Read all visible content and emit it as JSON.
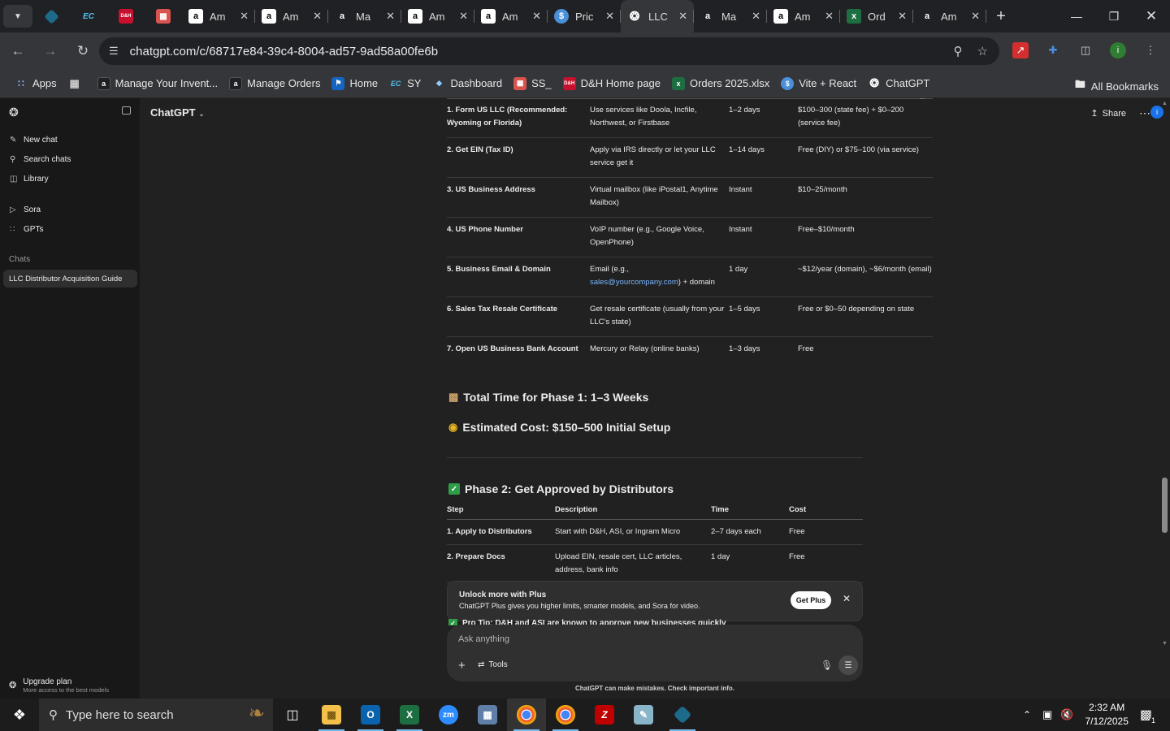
{
  "browser": {
    "tabs": [
      {
        "icon": "amazon-icon",
        "title": "Am"
      },
      {
        "icon": "amazon-icon",
        "title": "Am"
      },
      {
        "icon": "amazon-icon",
        "title": "Ma"
      },
      {
        "icon": "amazon-icon",
        "title": "Am"
      },
      {
        "icon": "amazon-icon",
        "title": "Am"
      },
      {
        "icon": "dollar-icon",
        "title": "Pric"
      },
      {
        "icon": "openai-icon",
        "title": "LLC"
      },
      {
        "icon": "amazon-icon",
        "title": "Ma"
      },
      {
        "icon": "amazon-icon",
        "title": "Am"
      },
      {
        "icon": "excel-icon",
        "title": "Ord"
      },
      {
        "icon": "amazon-icon",
        "title": "Am"
      }
    ],
    "pinned_labels": [
      "EC",
      "D&H"
    ],
    "url": "chatgpt.com/c/68717e84-39c4-8004-ad57-9ad58a00fe6b",
    "profile_initial": "i",
    "bookmarks": [
      {
        "label": "Apps",
        "icon": "apps-grid-icon"
      },
      {
        "label": "",
        "icon": "grid-icon"
      },
      {
        "label": "Manage Your Invent...",
        "icon": "amazon-icon"
      },
      {
        "label": "Manage Orders",
        "icon": "amazon-icon"
      },
      {
        "label": "Home",
        "icon": "site-icon"
      },
      {
        "label": "SY",
        "icon": "ec-icon"
      },
      {
        "label": "Dashboard",
        "icon": "dashboard-icon"
      },
      {
        "label": "SS_",
        "icon": "box-icon"
      },
      {
        "label": "D&H Home page",
        "icon": "dh-icon"
      },
      {
        "label": "Orders 2025.xlsx",
        "icon": "excel-icon"
      },
      {
        "label": "Vite + React",
        "icon": "dollar-icon"
      },
      {
        "label": "ChatGPT",
        "icon": "openai-icon"
      }
    ],
    "all_bookmarks": "All Bookmarks"
  },
  "sidebar": {
    "items": [
      {
        "label": "New chat",
        "icon": "edit-icon"
      },
      {
        "label": "Search chats",
        "icon": "search-icon"
      },
      {
        "label": "Library",
        "icon": "library-icon"
      },
      {
        "label": "Sora",
        "icon": "play-icon"
      },
      {
        "label": "GPTs",
        "icon": "grid-icon"
      }
    ],
    "section_label": "Chats",
    "chats": [
      "LLC Distributor Acquisition Guide"
    ],
    "upgrade": {
      "title": "Upgrade plan",
      "subtitle": "More access to the best models"
    }
  },
  "header": {
    "model": "ChatGPT",
    "share": "Share"
  },
  "phase1_table": {
    "rows": [
      {
        "step": "1. Form US LLC (Recommended: Wyoming or Florida)",
        "desc": "Use services like Doola, Incfile, Northwest, or Firstbase",
        "time": "1–2 days",
        "cost": "$100–300 (state fee) + $0–200 (service fee)"
      },
      {
        "step": "2. Get EIN (Tax ID)",
        "desc": "Apply via IRS directly or let your LLC service get it",
        "time": "1–14 days",
        "cost": "Free (DIY) or $75–100 (via service)"
      },
      {
        "step": "3. US Business Address",
        "desc": "Virtual mailbox (like iPostal1, Anytime Mailbox)",
        "time": "Instant",
        "cost": "$10–25/month"
      },
      {
        "step": "4. US Phone Number",
        "desc": "VoIP number (e.g., Google Voice, OpenPhone)",
        "time": "Instant",
        "cost": "Free–$10/month"
      },
      {
        "step": "5. Business Email & Domain",
        "desc_pre": "Email (e.g.,",
        "desc_link": "sales@yourcompany.com",
        "desc_post": ") + domain",
        "time": "1 day",
        "cost": "~$12/year (domain), ~$6/month (email)"
      },
      {
        "step": "6. Sales Tax Resale Certificate",
        "desc": "Get resale certificate (usually from your LLC’s state)",
        "time": "1–5 days",
        "cost": "Free or $0–50 depending on state"
      },
      {
        "step": "7. Open US Business Bank Account",
        "desc": "Mercury or Relay (online banks)",
        "time": "1–3 days",
        "cost": "Free"
      }
    ]
  },
  "summary": {
    "total_time": "Total Time for Phase 1: 1–3 Weeks",
    "estimated_cost": "Estimated Cost: $150–500 Initial Setup"
  },
  "phase2": {
    "heading": "Phase 2: Get Approved by Distributors",
    "headers": [
      "Step",
      "Description",
      "Time",
      "Cost"
    ],
    "rows": [
      {
        "step": "1. Apply to Distributors",
        "desc": "Start with D&H, ASI, or Ingram Micro",
        "time": "2–7 days each",
        "cost": "Free"
      },
      {
        "step": "2. Prepare Docs",
        "desc": "Upload EIN, resale cert, LLC articles, address, bank info",
        "time": "1 day",
        "cost": "Free"
      }
    ]
  },
  "promo": {
    "title": "Unlock more with Plus",
    "body": "ChatGPT Plus gives you higher limits, smarter models, and Sora for video.",
    "button": "Get Plus"
  },
  "peek_text": "Pro Tip: D&H and ASI are known to approve new businesses quickly",
  "composer": {
    "placeholder": "Ask anything",
    "tools": "Tools"
  },
  "disclaimer": "ChatGPT can make mistakes. Check important info.",
  "taskbar": {
    "search_placeholder": "Type here to search",
    "time": "2:32 AM",
    "date": "7/12/2025",
    "notification_count": "1"
  }
}
